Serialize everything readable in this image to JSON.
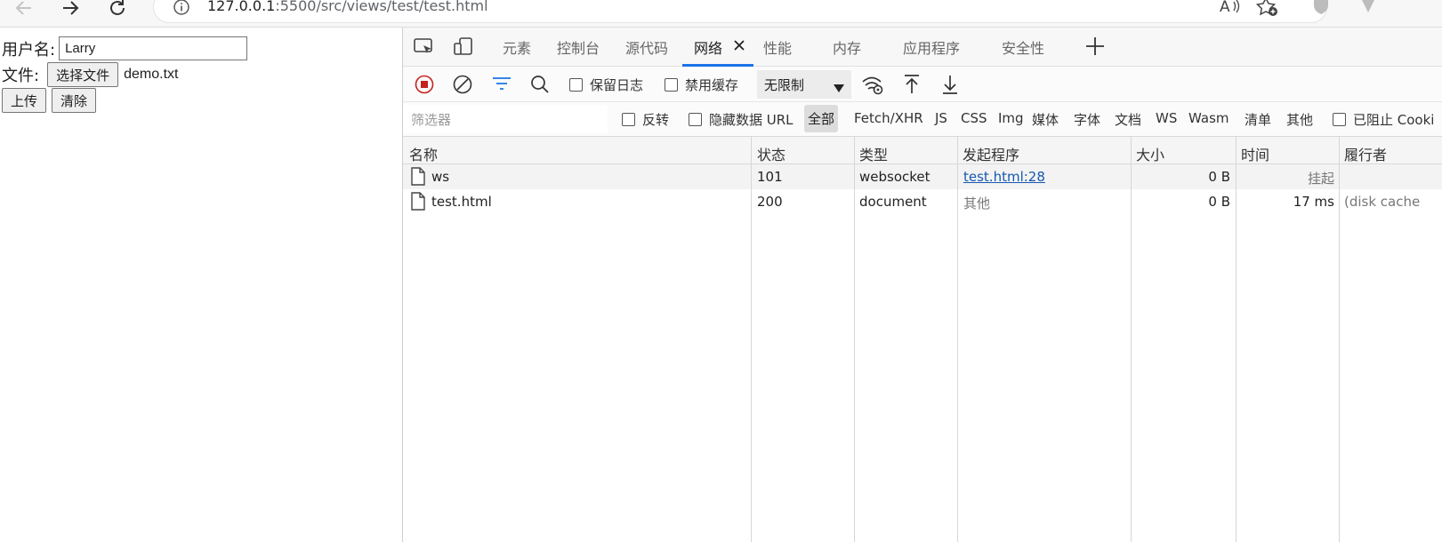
{
  "browser": {
    "url_host": "127.0.0.1",
    "url_rest": ":5500/src/views/test/test.html"
  },
  "form": {
    "username_label": "用户名:",
    "username_value": "Larry",
    "file_label": "文件:",
    "choose_file_label": "选择文件",
    "chosen_file_name": "demo.txt",
    "upload_label": "上传",
    "clear_label": "清除"
  },
  "devtools": {
    "tabs": [
      "元素",
      "控制台",
      "源代码",
      "网络",
      "性能",
      "内存",
      "应用程序",
      "安全性"
    ],
    "active_tab": "网络",
    "toolbar": {
      "preserve_log_label": "保留日志",
      "disable_cache_label": "禁用缓存",
      "throttle_value": "无限制"
    },
    "filter": {
      "placeholder": "筛选器",
      "invert_label": "反转",
      "hide_data_url_label": "隐藏数据 URL",
      "types": [
        "全部",
        "Fetch/XHR",
        "JS",
        "CSS",
        "Img",
        "媒体",
        "字体",
        "文档",
        "WS",
        "Wasm",
        "清单",
        "其他"
      ],
      "blocked_label": "已阻止 Cooki"
    },
    "table": {
      "columns": [
        "名称",
        "状态",
        "类型",
        "发起程序",
        "大小",
        "时间",
        "履行者"
      ],
      "rows": [
        {
          "name": "ws",
          "status": "101",
          "type": "websocket",
          "initiator": "test.html:28",
          "size": "0 B",
          "time": "挂起",
          "fulfilled_by": ""
        },
        {
          "name": "test.html",
          "status": "200",
          "type": "document",
          "initiator": "其他",
          "size": "0 B",
          "time": "17 ms",
          "fulfilled_by": "(disk cache"
        }
      ]
    }
  },
  "colors": {
    "accent": "#1a73e8",
    "record_red": "#c5221f",
    "link": "#1558b0"
  }
}
